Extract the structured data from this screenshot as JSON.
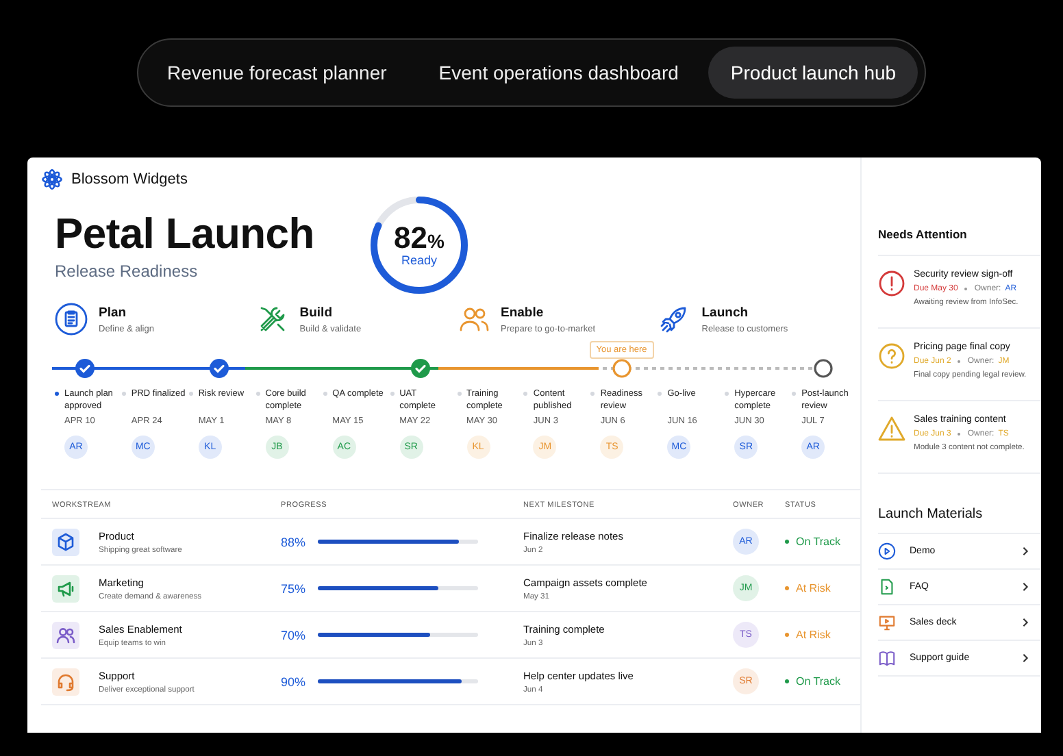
{
  "tabs": [
    {
      "label": "Revenue forecast planner",
      "selected": false
    },
    {
      "label": "Event operations dashboard",
      "selected": false
    },
    {
      "label": "Product launch hub",
      "selected": true
    }
  ],
  "brand": {
    "name": "Blossom Widgets"
  },
  "header": {
    "title": "Petal Launch",
    "subtitle": "Release Readiness",
    "readiness": "82",
    "unit": "%",
    "level": 0.82,
    "ring_label": "Ready"
  },
  "phases": [
    {
      "kind": "plan",
      "name": "Plan",
      "description": "Define & align",
      "color": "#1d5bd8"
    },
    {
      "kind": "build",
      "name": "Build",
      "description": "Build & validate",
      "color": "#1f9a4a"
    },
    {
      "kind": "enable",
      "name": "Enable",
      "description": "Prepare to go-to-market",
      "color": "#e8952f"
    },
    {
      "kind": "launch",
      "name": "Launch",
      "description": "Release to customers",
      "color": "#1d5bd8"
    }
  ],
  "timeline": {
    "level": 0.708
  },
  "milestones": [
    {
      "label": "Launch plan approved",
      "date": "APR 10",
      "owner": "AR",
      "color": "#1d5bd8",
      "highlighted": true,
      "checkpoint": {
        "done": true,
        "current": false
      }
    },
    {
      "label": "PRD finalized",
      "date": "APR 24",
      "owner": "MC",
      "color": "#1d5bd8",
      "highlighted": false
    },
    {
      "label": "Risk review",
      "date": "MAY 1",
      "owner": "KL",
      "color": "#1d5bd8",
      "highlighted": false,
      "checkpoint": {
        "done": true,
        "current": false
      }
    },
    {
      "label": "Core build complete",
      "date": "MAY 8",
      "owner": "JB",
      "color": "#1f9a4a",
      "highlighted": false
    },
    {
      "label": "QA complete",
      "date": "MAY 15",
      "owner": "AC",
      "color": "#1f9a4a",
      "highlighted": false
    },
    {
      "label": "UAT complete",
      "date": "MAY 22",
      "owner": "SR",
      "color": "#1f9a4a",
      "highlighted": false,
      "checkpoint": {
        "done": true,
        "current": false
      }
    },
    {
      "label": "Training complete",
      "date": "MAY 30",
      "owner": "KL",
      "color": "#e8952f",
      "highlighted": false
    },
    {
      "label": "Content published",
      "date": "JUN 3",
      "owner": "JM",
      "color": "#e8952f",
      "highlighted": false
    },
    {
      "label": "Readiness review",
      "date": "JUN 6",
      "owner": "TS",
      "color": "#e8952f",
      "highlighted": false,
      "checkpoint": {
        "done": false,
        "current": true,
        "tag": "You are here"
      }
    },
    {
      "label": "Go-live",
      "date": "JUN 16",
      "owner": "MC",
      "color": "#1d5bd8",
      "highlighted": false
    },
    {
      "label": "Hypercare complete",
      "date": "JUN 30",
      "owner": "SR",
      "color": "#1d5bd8",
      "highlighted": false
    },
    {
      "label": "Post-launch review",
      "date": "JUL 7",
      "owner": "AR",
      "color": "#1d5bd8",
      "highlighted": false,
      "checkpoint": {
        "done": false,
        "current": false
      }
    }
  ],
  "table": {
    "columns": [
      "WORKSTREAM",
      "PROGRESS",
      "NEXT MILESTONE",
      "OWNER",
      "STATUS"
    ],
    "rows": [
      {
        "kind": "product",
        "name": "Product",
        "description": "Shipping great software",
        "color": "#1d5bd8",
        "progress": "88%",
        "level": 0.88,
        "milestone": "Finalize release notes",
        "date": "Jun 2",
        "owner": "AR",
        "at_risk": false,
        "status": "On Track"
      },
      {
        "kind": "marketing",
        "name": "Marketing",
        "description": "Create demand & awareness",
        "color": "#1f9a4a",
        "progress": "75%",
        "level": 0.75,
        "milestone": "Campaign assets complete",
        "date": "May 31",
        "owner": "JM",
        "at_risk": true,
        "status": "At Risk"
      },
      {
        "kind": "sales",
        "name": "Sales Enablement",
        "description": "Equip teams to win",
        "color": "#7a5cc8",
        "progress": "70%",
        "level": 0.7,
        "milestone": "Training complete",
        "date": "Jun 3",
        "owner": "TS",
        "at_risk": true,
        "status": "At Risk"
      },
      {
        "kind": "support",
        "name": "Support",
        "description": "Deliver exceptional support",
        "color": "#e07a2f",
        "progress": "90%",
        "level": 0.9,
        "milestone": "Help center updates live",
        "date": "Jun 4",
        "owner": "SR",
        "at_risk": false,
        "status": "On Track"
      }
    ]
  },
  "attention": {
    "title": "Needs Attention",
    "items": [
      {
        "kind": "error",
        "title": "Security review sign-off",
        "due": "Due May 30",
        "owner_label": "Owner:",
        "owner": "AR",
        "note": "Awaiting review from InfoSec."
      },
      {
        "kind": "question",
        "title": "Pricing page final copy",
        "due": "Due Jun 2",
        "owner_label": "Owner:",
        "owner": "JM",
        "note": "Final copy pending legal review."
      },
      {
        "kind": "warning",
        "title": "Sales training content",
        "due": "Due Jun 3",
        "owner_label": "Owner:",
        "owner": "TS",
        "note": "Module 3 content not complete."
      }
    ]
  },
  "materials": {
    "title": "Launch Materials",
    "items": [
      {
        "kind": "demo",
        "label": "Demo"
      },
      {
        "kind": "faq",
        "label": "FAQ"
      },
      {
        "kind": "deck",
        "label": "Sales deck"
      },
      {
        "kind": "guide",
        "label": "Support guide"
      }
    ]
  }
}
